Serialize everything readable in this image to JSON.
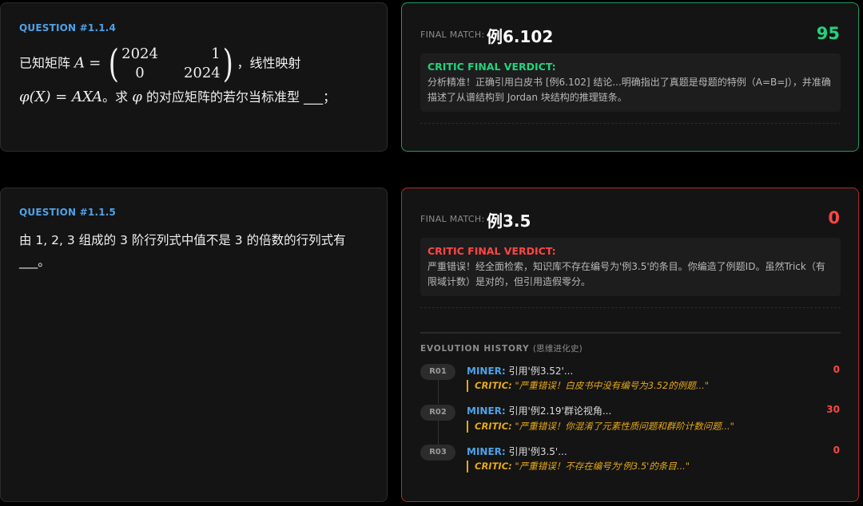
{
  "questions": [
    {
      "label": "QUESTION #1.1.4",
      "text_part1": "已知矩阵",
      "var_A": "A",
      "equals": "=",
      "matrix": [
        "2024",
        "1",
        "0",
        "2024"
      ],
      "text_part2": "，线性映射",
      "phi_expr": "φ(X) = AXA",
      "text_part3": "。求",
      "phi": "φ",
      "text_part4": "的对应矩阵的若尔当标准型 ___；"
    },
    {
      "label": "QUESTION #1.1.5",
      "text": "由 1, 2, 3 组成的 3 阶行列式中值不是 3 的倍数的行列式有 ___。"
    }
  ],
  "matches": [
    {
      "status": "good",
      "final_match_label": "FINAL MATCH:",
      "final_match_value": "例6.102",
      "score": "95",
      "verdict_title": "CRITIC FINAL VERDICT:",
      "verdict_text": "分析精准！正确引用白皮书 [例6.102] 结论...明确指出了真题是母题的特例（A=B=J），并准确描述了从谱结构到 Jordan 块结构的推理链条。"
    },
    {
      "status": "bad",
      "final_match_label": "FINAL MATCH:",
      "final_match_value": "例3.5",
      "score": "0",
      "verdict_title": "CRITIC FINAL VERDICT:",
      "verdict_text": "严重错误！经全面检索，知识库不存在编号为'例3.5'的条目。你编造了例题ID。虽然Trick（有限域计数）是对的，但引用造假零分。",
      "history_title": "EVOLUTION HISTORY",
      "history_subtitle": "(思维进化史)",
      "history": [
        {
          "round": "R01",
          "miner_label": "MINER:",
          "miner_text": "引用'例3.52'...",
          "critic_label": "CRITIC:",
          "critic_text": "\"严重错误！白皮书中没有编号为3.52的例题...\"",
          "score": "0"
        },
        {
          "round": "R02",
          "miner_label": "MINER:",
          "miner_text": "引用'例2.19'群论视角...",
          "critic_label": "CRITIC:",
          "critic_text": "\"严重错误！你混淆了元素性质问题和群阶计数问题...\"",
          "score": "30"
        },
        {
          "round": "R03",
          "miner_label": "MINER:",
          "miner_text": "引用'例3.5'...",
          "critic_label": "CRITIC:",
          "critic_text": "\"严重错误！不存在编号为'例3.5'的条目...\"",
          "score": "0"
        }
      ]
    }
  ],
  "colors": {
    "good": "#22d37d",
    "bad": "#ff4646",
    "question_label": "#4ea1e8",
    "critic": "#e6a817"
  }
}
